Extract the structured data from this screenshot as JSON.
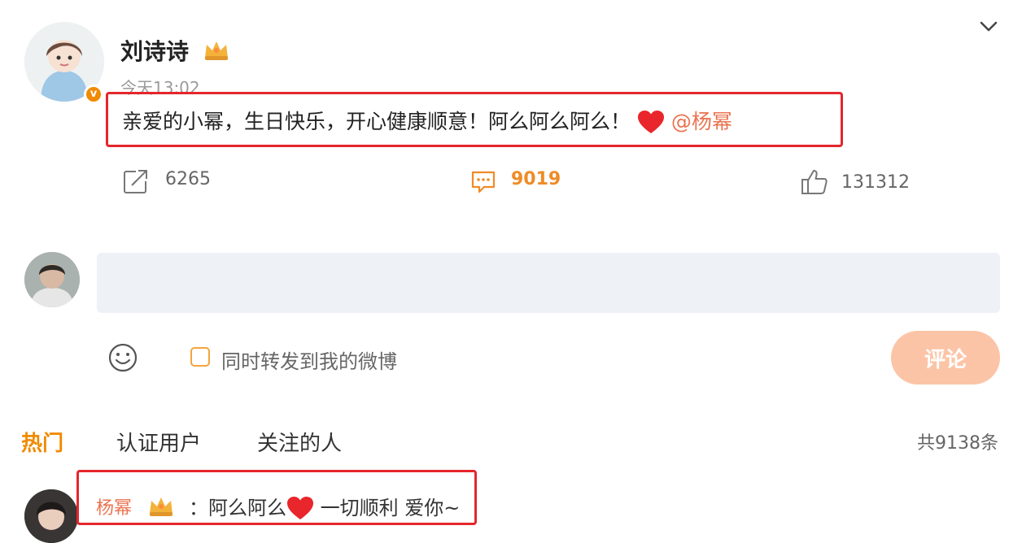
{
  "post": {
    "author_name": "刘诗诗",
    "timestamp": "今天13:02",
    "text": "亲爱的小幂，生日快乐，开心健康顺意！阿么阿么阿么！",
    "mention": "@杨幂",
    "actions": {
      "forward_count": "6265",
      "comment_count": "9019",
      "like_count": "131312"
    }
  },
  "composer": {
    "input_value": "",
    "repost_label": "同时转发到我的微博",
    "submit_label": "评论"
  },
  "tabs": {
    "hot": "热门",
    "verified": "认证用户",
    "following": "关注的人"
  },
  "total_count": "共9138条",
  "top_comment": {
    "author_name": "杨幂",
    "text_before_heart": "：阿么阿么",
    "text_after_heart": " 一切顺利 爱你~"
  },
  "colors": {
    "accent": "#f08a00",
    "mention": "#eb7350",
    "highlight_border": "#e5262b",
    "submit_bg": "#fcc4a6"
  },
  "icons": {
    "forward": "forward-icon",
    "comment": "comment-icon",
    "like": "thumbs-up-icon",
    "emoji": "smiley-icon",
    "verified": "verified-badge-icon",
    "crown": "crown-badge-icon",
    "heart": "heart-icon",
    "expand": "chevron-down-icon"
  }
}
